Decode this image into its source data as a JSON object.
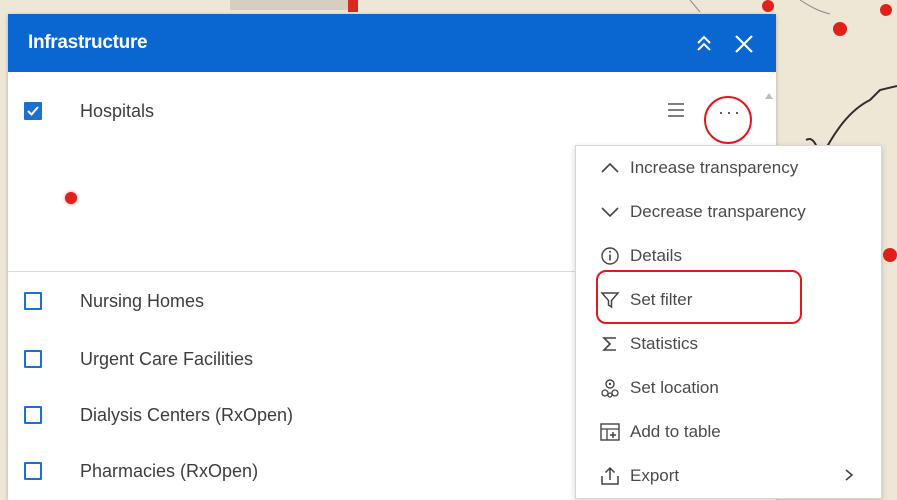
{
  "panel": {
    "title": "Infrastructure",
    "colors": {
      "header": "#0a66d1",
      "accent": "#1f6fcc",
      "highlight": "#e3181f",
      "legend_dot": "#e0211b"
    }
  },
  "layers": [
    {
      "label": "Hospitals",
      "checked": true
    },
    {
      "label": "Nursing Homes",
      "checked": false
    },
    {
      "label": "Urgent Care Facilities",
      "checked": false
    },
    {
      "label": "Dialysis Centers (RxOpen)",
      "checked": false
    },
    {
      "label": "Pharmacies (RxOpen)",
      "checked": false
    }
  ],
  "menu": {
    "items": [
      {
        "label": "Increase transparency",
        "icon": "chevron-up-icon"
      },
      {
        "label": "Decrease transparency",
        "icon": "chevron-down-icon"
      },
      {
        "label": "Details",
        "icon": "info-icon"
      },
      {
        "label": "Set filter",
        "icon": "filter-icon"
      },
      {
        "label": "Statistics",
        "icon": "sigma-icon"
      },
      {
        "label": "Set location",
        "icon": "location-icon"
      },
      {
        "label": "Add to table",
        "icon": "table-add-icon"
      },
      {
        "label": "Export",
        "icon": "export-icon",
        "submenu": true
      }
    ]
  },
  "icons": {
    "header_collapse": "double-chevron-up-icon",
    "header_close": "close-icon",
    "legend_toggle": "list-icon",
    "more_options": "more-options-icon",
    "more_options_glyph": "···"
  }
}
